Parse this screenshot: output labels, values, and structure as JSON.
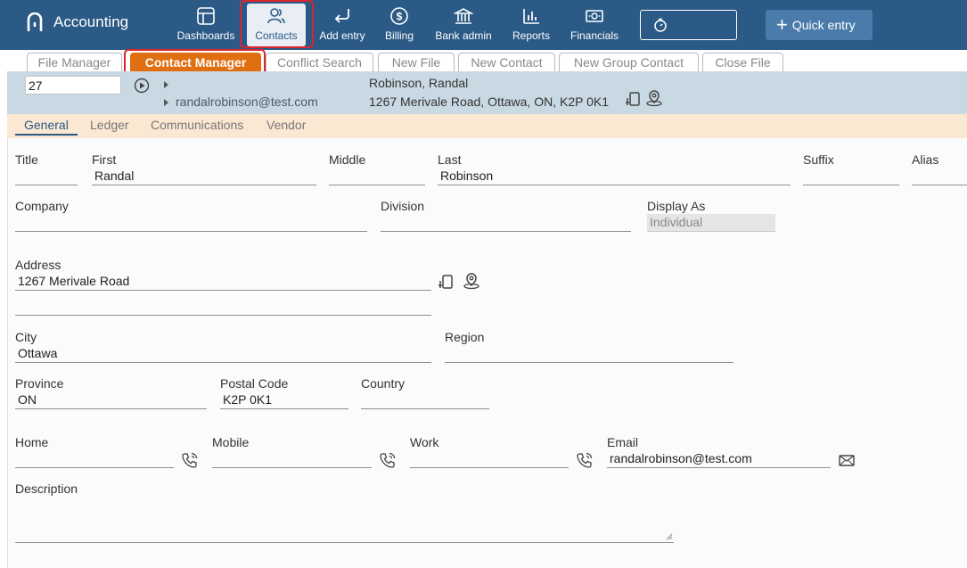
{
  "app": {
    "title": "Accounting"
  },
  "nav": {
    "dashboards": "Dashboards",
    "contacts": "Contacts",
    "add_entry": "Add entry",
    "billing": "Billing",
    "bank_admin": "Bank admin",
    "reports": "Reports",
    "financials": "Financials",
    "quick_entry": "Quick entry"
  },
  "tabs": {
    "file_manager": "File Manager",
    "contact_manager": "Contact Manager",
    "conflict_search": "Conflict Search",
    "new_file": "New File",
    "new_contact": "New Contact",
    "new_group_contact": "New Group Contact",
    "close_file": "Close File"
  },
  "header": {
    "file_number": "27",
    "email": "randalrobinson@test.com",
    "name": "Robinson, Randal",
    "address": "1267 Merivale Road, Ottawa, ON, K2P 0K1"
  },
  "subtabs": {
    "general": "General",
    "ledger": "Ledger",
    "communications": "Communications",
    "vendor": "Vendor"
  },
  "form": {
    "labels": {
      "title": "Title",
      "first": "First",
      "middle": "Middle",
      "last": "Last",
      "suffix": "Suffix",
      "alias": "Alias",
      "company": "Company",
      "division": "Division",
      "display_as": "Display As",
      "address": "Address",
      "city": "City",
      "region": "Region",
      "province": "Province",
      "postal_code": "Postal Code",
      "country": "Country",
      "home": "Home",
      "mobile": "Mobile",
      "work": "Work",
      "email": "Email",
      "description": "Description"
    },
    "values": {
      "title": "",
      "first": "Randal",
      "middle": "",
      "last": "Robinson",
      "suffix": "",
      "alias": "",
      "company": "",
      "division": "",
      "display_as": "Individual",
      "address1": "1267 Merivale Road",
      "address2": "",
      "city": "Ottawa",
      "region": "",
      "province": "ON",
      "postal_code": "K2P 0K1",
      "country": "",
      "home": "",
      "mobile": "",
      "work": "",
      "email": "randalrobinson@test.com",
      "description": ""
    }
  },
  "colors": {
    "topbar": "#2b5a86",
    "active_tab": "#e06f12",
    "header_bg": "#c9d9e3",
    "subtab_bg": "#fbe8d3",
    "highlight": "#d9262c"
  }
}
